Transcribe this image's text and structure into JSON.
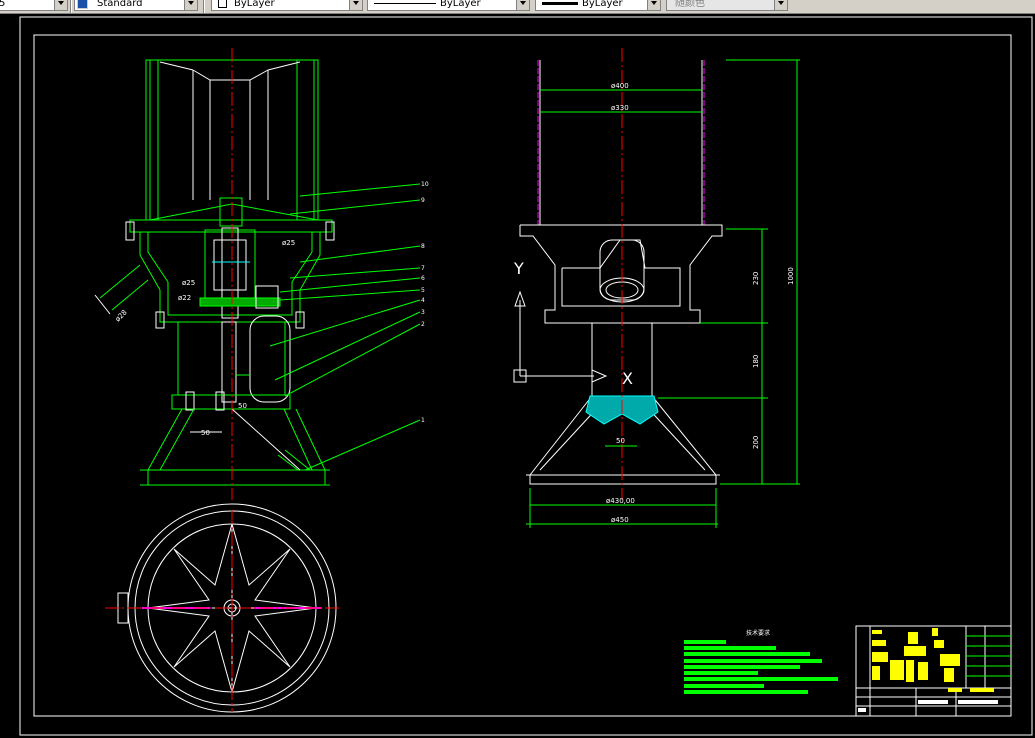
{
  "toolbar": {
    "layer_value": "5",
    "text_style_value": "Standard",
    "linetype_value": "ByLayer",
    "linetype_value_2": "ByLayer",
    "lineweight_value": "ByLayer",
    "plot_style_value": "随颜色"
  },
  "drawing": {
    "dim_d400": "ø400",
    "dim_d330": "ø330",
    "dim_230": "230",
    "dim_180": "180",
    "dim_200": "200",
    "dim_1000": "1000",
    "dim_50_right": "50",
    "dim_d430": "ø430,00",
    "dim_d450": "ø450",
    "dim_50_left": "50",
    "dim_d28": "ø28",
    "dim_d22": "ø22",
    "dim_d25a": "ø25",
    "dim_d25b": "ø25",
    "dim_50_small": "50",
    "axis_y": "Y",
    "axis_x": "X",
    "tech_title": "技术要求",
    "balloons": [
      "10",
      "9",
      "8",
      "7",
      "6",
      "5",
      "4",
      "3",
      "2",
      "1"
    ]
  },
  "colors": {
    "background": "#000000",
    "outline": "#ffffff",
    "geometry": "#00ff00",
    "center_line": "#ff0000",
    "magenta": "#ff00ff",
    "cyan": "#00ffff",
    "yellow": "#ffff00"
  }
}
